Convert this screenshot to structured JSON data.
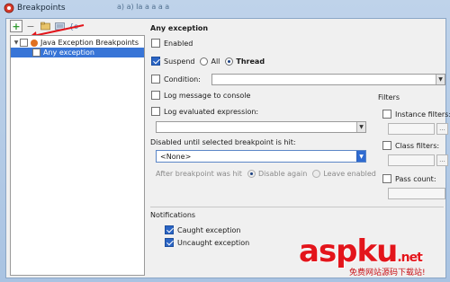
{
  "window": {
    "title": "Breakpoints",
    "title_right_hint": "a) a) Ia a a a a"
  },
  "toolbar": {
    "add": "+",
    "remove": "−",
    "icons": [
      "folder-up-icon",
      "folder-icon",
      "group-icon"
    ]
  },
  "tree": {
    "group_label": "Java Exception Breakpoints",
    "item_label": "Any exception"
  },
  "panel": {
    "heading": "Any exception",
    "enabled": "Enabled",
    "suspend": "Suspend",
    "suspend_all": "All",
    "suspend_thread": "Thread",
    "condition": "Condition:",
    "log_message": "Log message to console",
    "log_expression": "Log evaluated expression:",
    "disabled_until": "Disabled until selected breakpoint is hit:",
    "none_option": "<None>",
    "after_hit": "After breakpoint was hit",
    "disable_again": "Disable again",
    "leave_enabled": "Leave enabled",
    "notifications": "Notifications",
    "caught": "Caught exception",
    "uncaught": "Uncaught exception"
  },
  "filters": {
    "heading": "Filters",
    "instance": "Instance filters:",
    "class": "Class filters:",
    "pass_count": "Pass count:",
    "browse": "..."
  },
  "watermark": {
    "brand": "aspku",
    "suffix": ".net",
    "sub": "免费网站源码下载站!"
  },
  "colors": {
    "selection": "#3875d7",
    "annotation": "#e3151b"
  }
}
